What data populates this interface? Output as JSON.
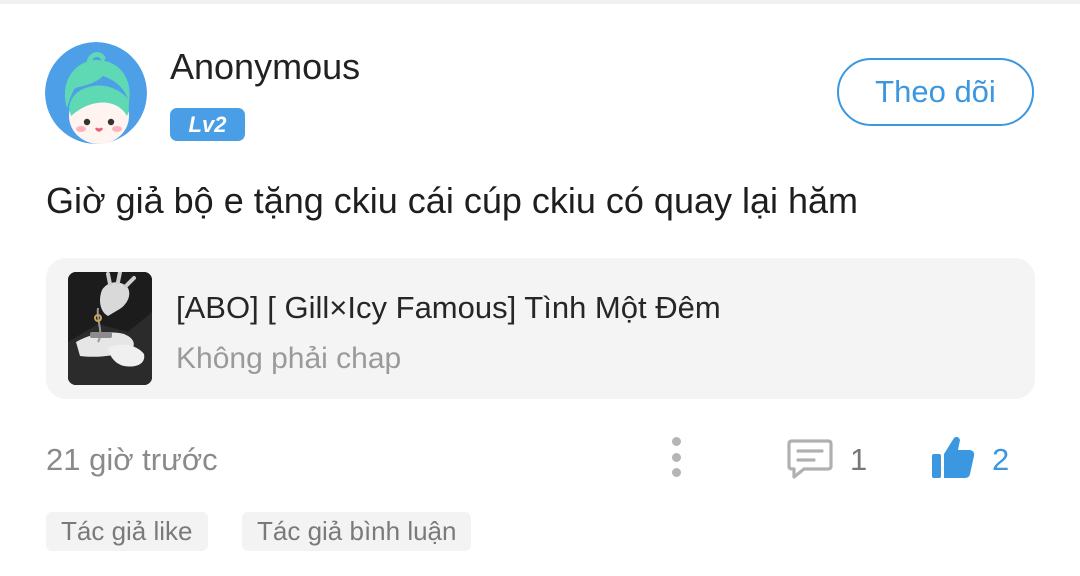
{
  "comment": {
    "user": {
      "name": "Anonymous",
      "level": "Lv2",
      "avatar_icon": "cartoon-avatar-icon"
    },
    "follow_label": "Theo dõi",
    "text": "Giờ giả bộ e tặng ckiu cái cúp ckiu có quay lại hăm",
    "linked_story": {
      "title": "[ABO] [ Gill×Icy Famous] Tình Một Đêm",
      "subtitle": "Không phải chap",
      "cover_icon": "story-cover-image"
    },
    "timestamp": "21 giờ trước",
    "replies": "1",
    "likes": "2",
    "tags": [
      "Tác giả like",
      "Tác giả bình luận"
    ]
  },
  "colors": {
    "accent": "#3b97e0",
    "badge": "#4a9ee6",
    "card_bg": "#f4f4f4",
    "muted": "#8a8a8a"
  }
}
